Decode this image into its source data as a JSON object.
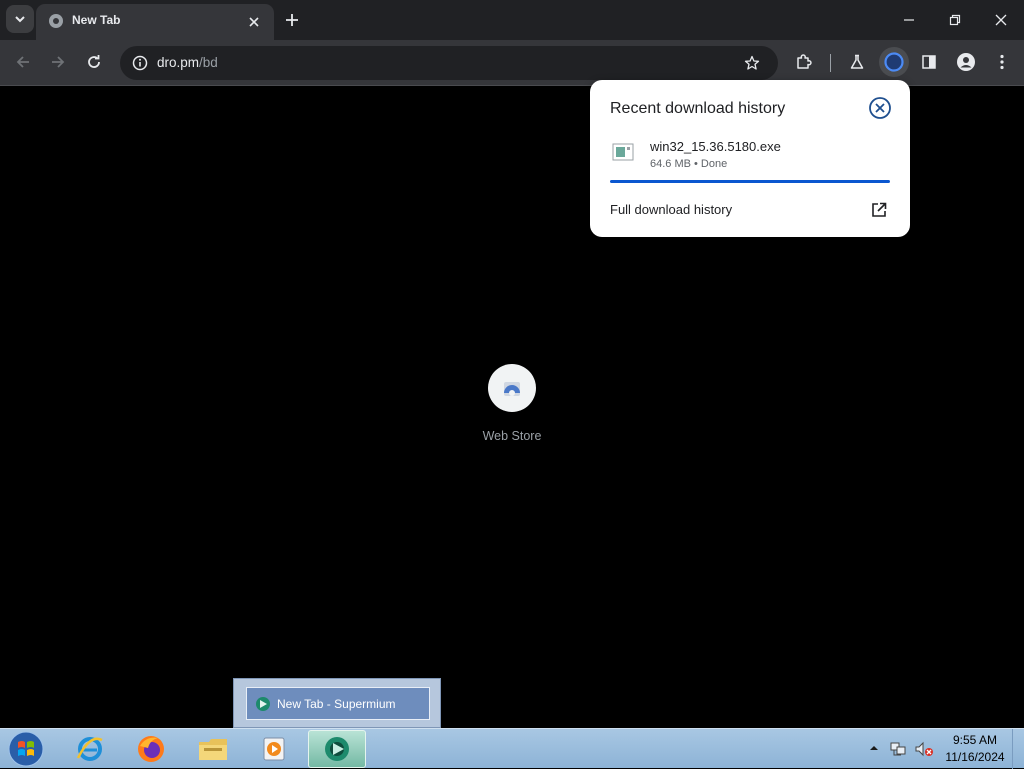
{
  "browser": {
    "tab": {
      "title": "New Tab"
    },
    "omnibox": {
      "url_host": "dro.pm",
      "url_path": "/bd"
    }
  },
  "content": {
    "shortcut": {
      "label": "Web Store"
    }
  },
  "download_bubble": {
    "title": "Recent download history",
    "item": {
      "filename": "win32_15.36.5180.exe",
      "status": "64.6 MB • Done",
      "progress": 1.0
    },
    "full_history_label": "Full download history",
    "accent_color": "#0b57d0"
  },
  "taskbar": {
    "preview_label": "New Tab - Supermium",
    "clock": {
      "time": "9:55 AM",
      "date": "11/16/2024"
    }
  },
  "icons": [
    "tab-search-icon",
    "globe-icon",
    "close-icon",
    "plus-icon",
    "minimize-icon",
    "restore-icon",
    "back-icon",
    "forward-icon",
    "reload-icon",
    "info-icon",
    "star-icon",
    "extensions-icon",
    "labs-icon",
    "download-icon",
    "side-panel-icon",
    "profile-icon",
    "menu-icon",
    "web-store-icon",
    "file-icon",
    "open-external-icon",
    "windows-start-icon",
    "internet-explorer-icon",
    "firefox-icon",
    "file-explorer-icon",
    "media-player-icon",
    "supermium-icon",
    "tray-up-arrow-icon",
    "network-icon",
    "volume-muted-icon"
  ]
}
